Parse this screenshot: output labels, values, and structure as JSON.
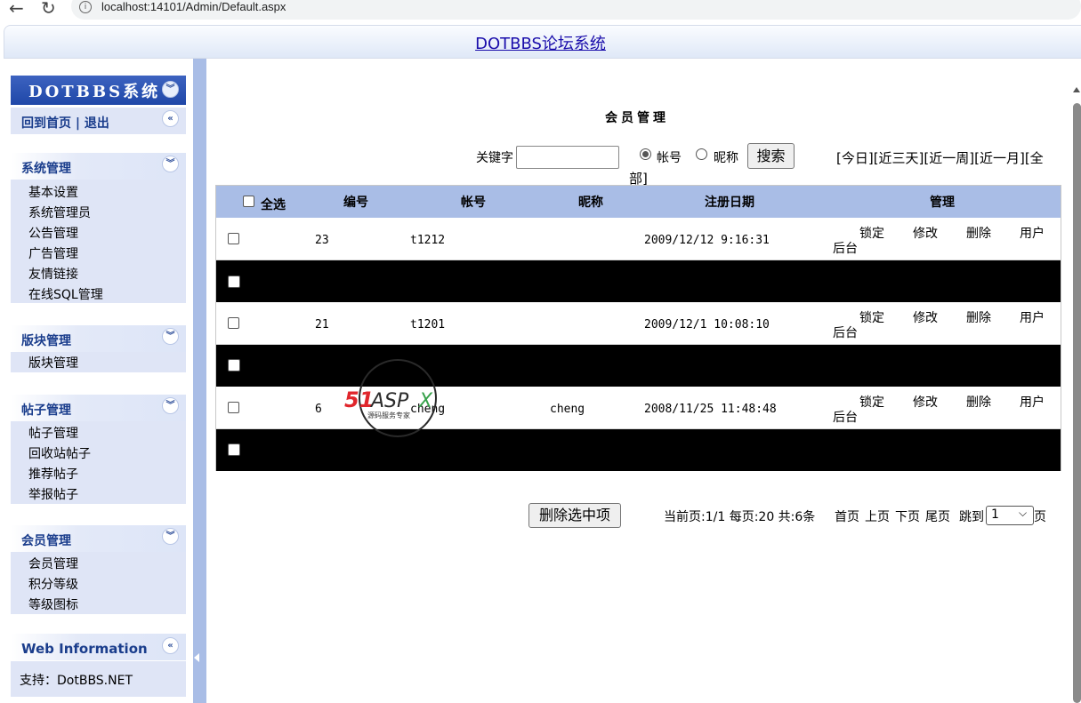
{
  "browser": {
    "url": "localhost:14101/Admin/Default.aspx"
  },
  "app": {
    "title": "DOTBBS论坛系统"
  },
  "sidebar": {
    "brand": "DOTBBS系统",
    "home_logout": "回到首页 | 退出",
    "sections": [
      {
        "title": "系统管理",
        "items": [
          "基本设置",
          "系统管理员",
          "公告管理",
          "广告管理",
          "友情链接",
          "在线SQL管理"
        ]
      },
      {
        "title": "版块管理",
        "items": [
          "版块管理"
        ]
      },
      {
        "title": "帖子管理",
        "items": [
          "帖子管理",
          "回收站帖子",
          "推荐帖子",
          "举报帖子"
        ]
      },
      {
        "title": "会员管理",
        "items": [
          "会员管理",
          "积分等级",
          "等级图标"
        ]
      }
    ],
    "info": {
      "title": "Web Information",
      "support": "支持：DotBBS.NET"
    }
  },
  "main": {
    "title": "会员管理",
    "search": {
      "keyword_label": "关键字",
      "keyword_value": "",
      "radio_account": "帐号",
      "radio_nickname": "昵称",
      "selected": "帐号",
      "button": "搜索",
      "quick_filters_line1": "[今日][近三天][近一周][近一月][全",
      "quick_filters_line2": "部]"
    },
    "table": {
      "headers": {
        "select_all": "全选",
        "id": "编号",
        "account": "帐号",
        "nickname": "昵称",
        "reg_date": "注册日期",
        "manage": "管理"
      },
      "rows": [
        {
          "id": "23",
          "account": "t1212",
          "nickname": "",
          "date": "2009/12/12 9:16:31"
        },
        {
          "id": "21",
          "account": "t1201",
          "nickname": "",
          "date": "2009/12/1 10:08:10"
        },
        {
          "id": "6",
          "account": "cheng",
          "nickname": "cheng",
          "date": "2008/11/25 11:48:48"
        }
      ],
      "actions": {
        "lock": "锁定",
        "edit": "修改",
        "delete": "删除",
        "user_line1": "用户",
        "user_line2": "后台"
      }
    },
    "delete_selected": "删除选中项",
    "pager": {
      "status": "当前页:1/1 每页:20 共:6条",
      "first": "首页",
      "prev": "上页",
      "next": "下页",
      "last": "尾页",
      "jump_label": "跳到",
      "jump_value": "1",
      "page_suffix": "页"
    },
    "watermark": {
      "brand": "51ASPX",
      "tagline": "源码服务专家"
    }
  }
}
